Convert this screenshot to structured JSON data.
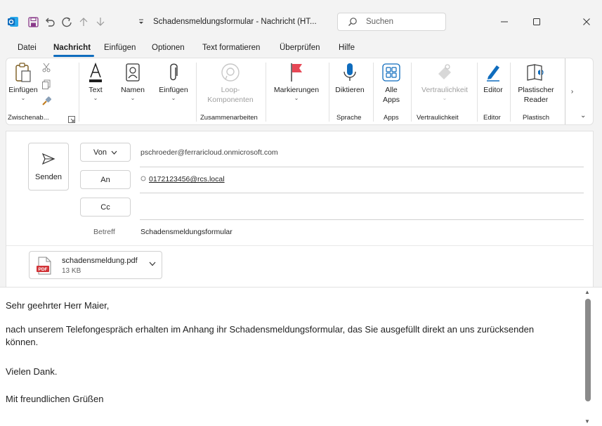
{
  "titlebar": {
    "title": "Schadensmeldungsformular - Nachricht (HT...",
    "search_placeholder": "Suchen",
    "icons": [
      "outlook-app-icon",
      "save-icon",
      "undo-icon",
      "redo-icon",
      "arrow-up-icon",
      "arrow-down-icon",
      "quick-access-dropdown-icon"
    ]
  },
  "menu": {
    "items": [
      "Datei",
      "Nachricht",
      "Einfügen",
      "Optionen",
      "Text formatieren",
      "Überprüfen",
      "Hilfe"
    ],
    "active": "Nachricht"
  },
  "ribbon": {
    "buttons": {
      "paste": "Einfügen",
      "text": "Text",
      "names": "Namen",
      "insert": "Einfügen",
      "loop_line1": "Loop-",
      "loop_line2": "Komponenten",
      "tags": "Markierungen",
      "dictate": "Diktieren",
      "apps_line1": "Alle",
      "apps_line2": "Apps",
      "sensitivity": "Vertraulichkeit",
      "editor": "Editor",
      "reader_line1": "Plastischer",
      "reader_line2": "Reader"
    },
    "groups": {
      "clipboard": "Zwischenab...",
      "collab": "Zusammenarbeiten",
      "voice": "Sprache",
      "apps": "Apps",
      "sensitivity": "Vertraulichkeit",
      "editor": "Editor",
      "reader": "Plastisch"
    },
    "more": "›",
    "expand": "⌄"
  },
  "compose": {
    "send_label": "Senden",
    "from_label": "Von",
    "from_value": "pschroeder@ferraricloud.onmicrosoft.com",
    "to_label": "An",
    "to_value": "0172123456@rcs.local",
    "cc_label": "Cc",
    "subject_label": "Betreff",
    "subject_value": "Schadensmeldungsformular"
  },
  "attachment": {
    "name": "schadensmeldung.pdf",
    "size": "13 KB",
    "badge": "PDF"
  },
  "body": {
    "greeting": "Sehr geehrter Herr Maier,",
    "paragraph": "nach unserem Telefongespräch erhalten im Anhang ihr Schadensmeldungsformular, das Sie ausgefüllt direkt an uns zurücksenden können.",
    "thanks": "Vielen Dank.",
    "closing": "Mit freundlichen Grüßen"
  },
  "colors": {
    "accent": "#0f6cbd",
    "tag_red": "#e74856",
    "pdf_red": "#d13438"
  }
}
